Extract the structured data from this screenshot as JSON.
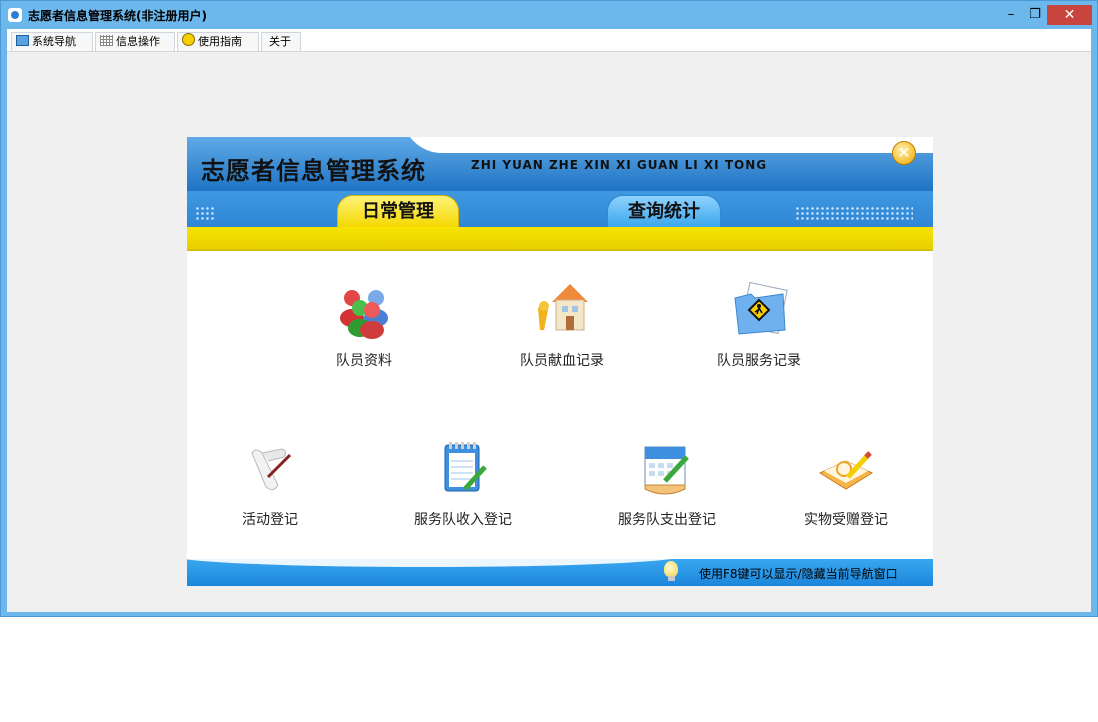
{
  "window": {
    "title": "志愿者信息管理系统(非注册用户)",
    "controls": {
      "minimize": "–",
      "restore": "❐",
      "close": "✕"
    }
  },
  "menubar": {
    "items": [
      {
        "label": "系统导航",
        "icon": "monitor-icon"
      },
      {
        "label": "信息操作",
        "icon": "grid-icon"
      },
      {
        "label": "使用指南",
        "icon": "help-icon"
      },
      {
        "label": "关于",
        "icon": ""
      }
    ]
  },
  "nav_panel": {
    "title_cn": "志愿者信息管理系统",
    "title_pinyin": "ZHI YUAN ZHE XIN XI GUAN LI XI TONG",
    "close_icon": "close-circle-icon",
    "tabs": [
      {
        "label": "日常管理",
        "active": true
      },
      {
        "label": "查询统计",
        "active": false
      }
    ],
    "items_row1": [
      {
        "label": "队员资料",
        "icon": "people-group-icon"
      },
      {
        "label": "队员献血记录",
        "icon": "blood-donation-house-icon"
      },
      {
        "label": "队员服务记录",
        "icon": "service-folder-icon"
      }
    ],
    "items_row2": [
      {
        "label": "活动登记",
        "icon": "scroll-pen-icon"
      },
      {
        "label": "服务队收入登记",
        "icon": "notepad-pencil-icon"
      },
      {
        "label": "服务队支出登记",
        "icon": "calendar-pencil-icon"
      },
      {
        "label": "实物受赠登记",
        "icon": "notebook-pencil-icon"
      }
    ],
    "footer_hint": "使用F8键可以显示/隐藏当前导航窗口",
    "colors": {
      "header_blue": "#1f74c4",
      "tab_yellow": "#f4d800",
      "footer_blue": "#1b86db"
    }
  }
}
